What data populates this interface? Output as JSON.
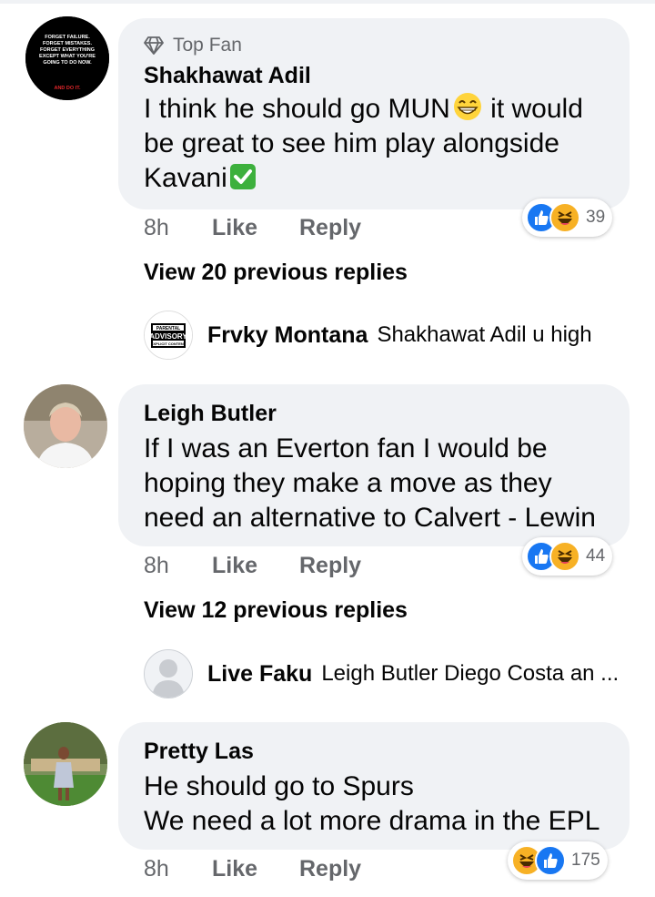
{
  "comments": [
    {
      "badge": "Top Fan",
      "avatar_text": {
        "lines": [
          "FORGET FAILURE.",
          "FORGET MISTAKES.",
          "FORGET EVERYTHING",
          "EXCEPT WHAT YOU'RE",
          "GOING TO DO NOW."
        ],
        "tag": "AND DO IT."
      },
      "name": "Shakhawat Adil",
      "lines": [
        "I think he should go MUN",
        " it would",
        "be great to see him play alongside",
        "Kavani"
      ],
      "time": "8h",
      "like": "Like",
      "reply": "Reply",
      "reaction_count": "39",
      "reactions": [
        "like-icon",
        "haha-icon"
      ],
      "view_replies": "View 20 previous replies",
      "last_reply": {
        "name": "Frvky Montana",
        "text": "Shakhawat Adil u high",
        "avatar_text": [
          "PARENTAL",
          "ADVISORY",
          "EXPLICIT CONTENT"
        ]
      }
    },
    {
      "name": "Leigh Butler",
      "lines": [
        "If I was an Everton fan I would be",
        "hoping they make a move as they",
        "need an alternative to Calvert - Lewin"
      ],
      "time": "8h",
      "like": "Like",
      "reply": "Reply",
      "reaction_count": "44",
      "reactions": [
        "like-icon",
        "haha-icon"
      ],
      "view_replies": "View 12 previous replies",
      "last_reply": {
        "name": "Live Faku",
        "text": "Leigh Butler Diego Costa an ..."
      }
    },
    {
      "name": "Pretty Las",
      "lines": [
        "He should go to Spurs",
        "We need a lot more drama in the EPL"
      ],
      "time": "8h",
      "like": "Like",
      "reply": "Reply",
      "reaction_count": "175",
      "reactions": [
        "haha-icon",
        "like-icon"
      ]
    }
  ],
  "colors": {
    "bubble": "#f0f2f5",
    "meta": "#65676b",
    "like_blue": "#1877f2",
    "haha_yellow": "#f7b125"
  }
}
